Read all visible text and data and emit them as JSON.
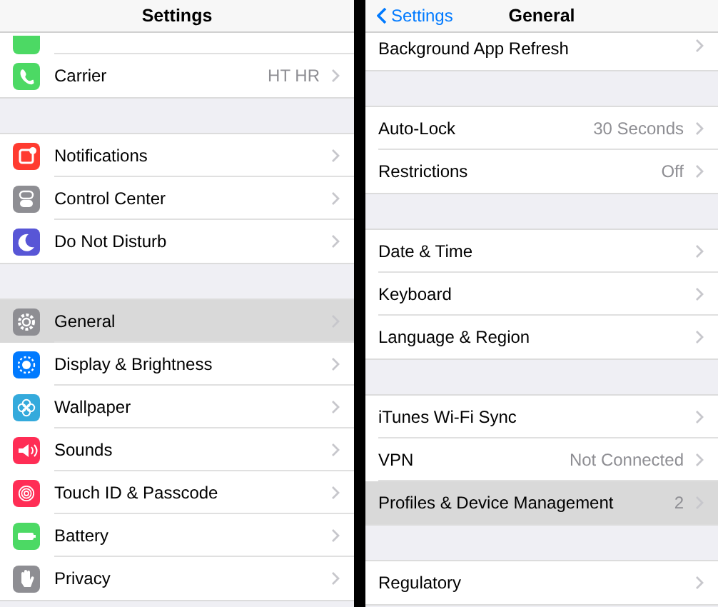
{
  "panes": [
    {
      "kind": "root",
      "nav": {
        "title": "Settings"
      },
      "groups": [
        {
          "rows": [
            {
              "kind": "cut",
              "selected": false
            },
            {
              "kind": "item",
              "label": "Carrier",
              "value": "HT HR",
              "selected": false
            }
          ]
        },
        {
          "rows": [
            {
              "kind": "item",
              "label": "Notifications",
              "selected": false
            },
            {
              "kind": "item",
              "label": "Control Center",
              "selected": false
            },
            {
              "kind": "item",
              "label": "Do Not Disturb",
              "selected": false
            }
          ]
        },
        {
          "rows": [
            {
              "kind": "item",
              "label": "General",
              "selected": true
            },
            {
              "kind": "item",
              "label": "Display & Brightness",
              "selected": false
            },
            {
              "kind": "item",
              "label": "Wallpaper",
              "selected": false
            },
            {
              "kind": "item",
              "label": "Sounds",
              "selected": false
            },
            {
              "kind": "item",
              "label": "Touch ID & Passcode",
              "selected": false
            },
            {
              "kind": "item",
              "label": "Battery",
              "selected": false
            },
            {
              "kind": "item",
              "label": "Privacy",
              "selected": false
            }
          ]
        }
      ]
    },
    {
      "kind": "detail",
      "nav": {
        "back": "Settings",
        "title": "General"
      },
      "groups": [
        {
          "rows": [
            {
              "kind": "top",
              "label": "Background App Refresh",
              "selected": false
            }
          ]
        },
        {
          "rows": [
            {
              "kind": "item",
              "label": "Auto-Lock",
              "value": "30 Seconds",
              "selected": false
            },
            {
              "kind": "item",
              "label": "Restrictions",
              "value": "Off",
              "selected": false
            }
          ]
        },
        {
          "rows": [
            {
              "kind": "item",
              "label": "Date & Time",
              "selected": false
            },
            {
              "kind": "item",
              "label": "Keyboard",
              "selected": false
            },
            {
              "kind": "item",
              "label": "Language & Region",
              "selected": false
            }
          ]
        },
        {
          "rows": [
            {
              "kind": "item",
              "label": "iTunes Wi-Fi Sync",
              "selected": false
            },
            {
              "kind": "item",
              "label": "VPN",
              "value": "Not Connected",
              "selected": false
            },
            {
              "kind": "item",
              "label": "Profiles & Device Management",
              "value": "2",
              "selected": true
            }
          ]
        },
        {
          "rows": [
            {
              "kind": "item",
              "label": "Regulatory",
              "selected": false
            }
          ]
        }
      ]
    }
  ]
}
